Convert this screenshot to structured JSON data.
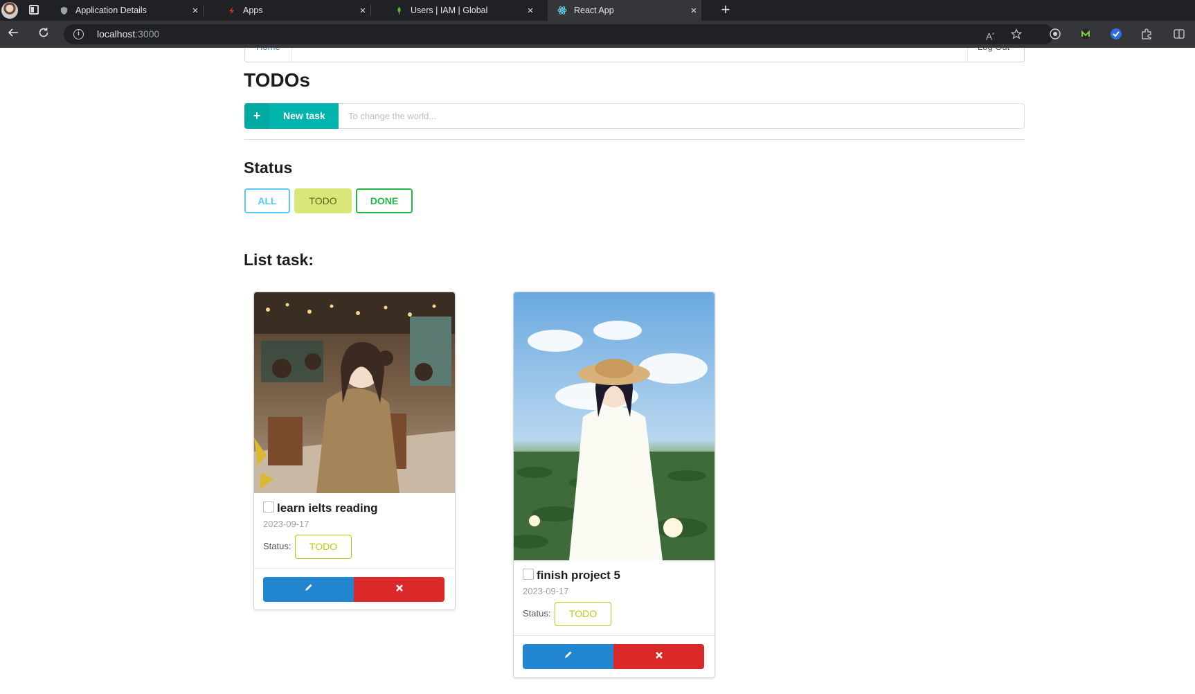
{
  "browser": {
    "tabs": [
      {
        "title": "Application Details",
        "icon": "shield-icon",
        "active": false
      },
      {
        "title": "Apps",
        "icon": "bolt-icon",
        "active": false
      },
      {
        "title": "Users | IAM | Global",
        "icon": "leaf-icon",
        "active": false
      },
      {
        "title": "React App",
        "icon": "react-icon",
        "active": true
      }
    ],
    "close_glyph": "×",
    "new_tab_glyph": "+",
    "url_host": "localhost",
    "url_port": ":3000"
  },
  "menu": {
    "home_label": "Home",
    "logout_label": "Log Out"
  },
  "app": {
    "title": "TODOs",
    "new_task_icon": "+",
    "new_task_label": "New task",
    "new_task_placeholder": "To change the world...",
    "status_heading": "Status",
    "filters": {
      "all": "ALL",
      "todo": "TODO",
      "done": "DONE"
    },
    "list_heading": "List task:"
  },
  "tasks": [
    {
      "title": "learn ielts reading",
      "date": "2023-09-17",
      "status_label": "Status:",
      "status": "TODO",
      "checked": false,
      "image": "cafe-girl-illustration"
    },
    {
      "title": "finish project 5",
      "date": "2023-09-17",
      "status_label": "Status:",
      "status": "TODO",
      "checked": false,
      "image": "lotus-field-girl-illustration"
    }
  ],
  "colors": {
    "teal": "#00b5ad",
    "blue": "#2185d0",
    "red": "#db2828",
    "olive": "#b5cc18",
    "green": "#21ba45",
    "lightblue": "#54c8ff",
    "todo_fill": "#d9e778"
  }
}
